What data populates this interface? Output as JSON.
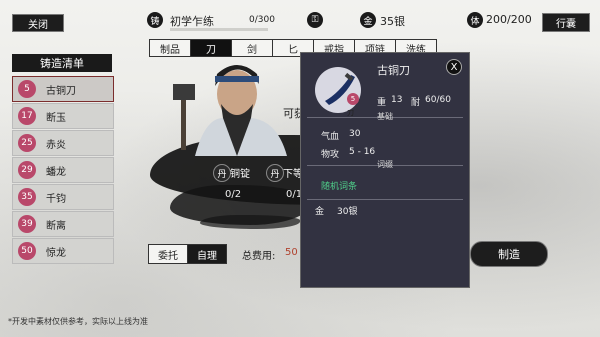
{
  "top": {
    "close_label": "关闭",
    "cast_icon_text": "铸",
    "rank_label": "初学乍练",
    "progress_text": "0/300",
    "progress_fraction": 0,
    "gold_icon_text": "金",
    "gold_text": "35银",
    "stamina_icon_text": "体",
    "stamina_text": "200/200",
    "bag_label": "行囊"
  },
  "tabs": [
    {
      "label": "制品",
      "active": false
    },
    {
      "label": "刀",
      "active": true
    },
    {
      "label": "剑",
      "active": false
    },
    {
      "label": "匕",
      "active": false
    },
    {
      "label": "戒指",
      "active": false
    },
    {
      "label": "项链",
      "active": false
    },
    {
      "label": "洗练",
      "active": false
    }
  ],
  "list": {
    "title": "铸造清单",
    "items": [
      {
        "level": "5",
        "name": "古铜刀"
      },
      {
        "level": "17",
        "name": "断玉"
      },
      {
        "level": "25",
        "name": "赤炎"
      },
      {
        "level": "29",
        "name": "蟠龙"
      },
      {
        "level": "35",
        "name": "千钧"
      },
      {
        "level": "39",
        "name": "断离"
      },
      {
        "level": "50",
        "name": "惊龙"
      }
    ]
  },
  "center": {
    "obtain_label": "可获",
    "mat1_icon": "丹",
    "mat1_name": "铜锭",
    "mat1_count": "0/2",
    "mat2_icon": "丹",
    "mat2_name": "下等",
    "mat2_count": "0/1"
  },
  "bottom": {
    "entrust_label": "委托",
    "self_label": "自理",
    "cost_label": "总费用:",
    "cost_value": "50",
    "craft_label": "制造",
    "footnote": "*开发中素材仅供参考，实际以上线为准"
  },
  "popup": {
    "name": "古铜刀",
    "close": "X",
    "badge_level": "5",
    "badge_type": "刀",
    "weight_label": "重",
    "weight_value": "13",
    "durability_label": "耐",
    "durability_value": "60/60",
    "section_basic": "基础",
    "qi_label": "气血",
    "qi_value": "30",
    "atk_label": "物攻",
    "atk_value": "5 - 16",
    "section_affix": "词缀",
    "affix": "随机词条",
    "gold_label": "金",
    "gold_value": "30银"
  },
  "colors": {
    "accent_pink": "#b9486a",
    "affix_green": "#4fd08a",
    "popup_bg": "#323241"
  }
}
